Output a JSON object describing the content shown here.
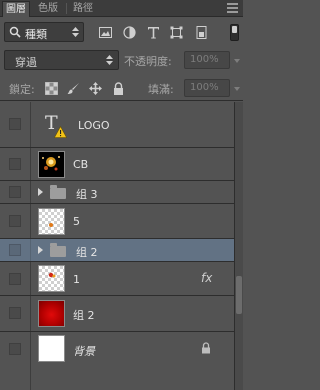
{
  "tabs": [
    "圖層",
    "色版",
    "路徑"
  ],
  "filter": {
    "kind_label": "種類"
  },
  "filter_icons": [
    "image-filter-icon",
    "adjustment-filter-icon",
    "type-filter-icon",
    "shape-filter-icon",
    "smart-object-filter-icon"
  ],
  "blend": {
    "mode": "穿過",
    "opacity_label": "不透明度:",
    "opacity_value": "100%"
  },
  "lock": {
    "label": "鎖定:",
    "fill_label": "填滿:",
    "fill_value": "100%"
  },
  "layers": [
    {
      "name": "LOGO",
      "kind": "type",
      "warning": true
    },
    {
      "name": "CB",
      "kind": "image",
      "thumb": "black"
    },
    {
      "name": "组 3",
      "kind": "group"
    },
    {
      "name": "5",
      "kind": "image",
      "thumb": "checker"
    },
    {
      "name": "组 2",
      "kind": "group",
      "selected": true
    },
    {
      "name": "1",
      "kind": "image",
      "thumb": "checker",
      "fx": "fx"
    },
    {
      "name": "组 2",
      "kind": "image",
      "thumb": "red"
    },
    {
      "name": "背景",
      "kind": "background",
      "thumb": "white",
      "locked": true
    }
  ],
  "colors": {
    "panel": "#535353",
    "selected": "#627284",
    "tabbar": "#3c3c3c"
  }
}
